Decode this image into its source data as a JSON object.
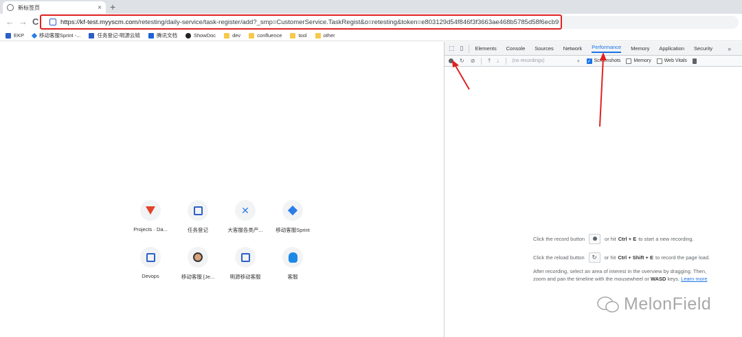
{
  "browser": {
    "tab_title": "新标签页",
    "tab_close": "×",
    "new_tab": "+",
    "back": "←",
    "forward": "→",
    "reload": "C",
    "url_host": "https://kf-test.myyscm.com",
    "url_path": "/retesting/daily-service/task-register/add?_smp=CustomerService.TaskRegist&o=retesting&token=e803129d54f846f3f3663ae468b5785d58f6ecb9"
  },
  "bookmarks": [
    {
      "label": "EKP",
      "icon": "ekp-icon"
    },
    {
      "label": "移动客服Sprint -...",
      "icon": "diamond-icon"
    },
    {
      "label": "任务登记-明源云链",
      "icon": "doc-icon"
    },
    {
      "label": "腾讯文档",
      "icon": "tencent-icon"
    },
    {
      "label": "ShowDoc",
      "icon": "showdoc-icon"
    },
    {
      "label": "dev",
      "icon": "folder-icon"
    },
    {
      "label": "confluence",
      "icon": "folder-icon"
    },
    {
      "label": "tool",
      "icon": "folder-icon"
    },
    {
      "label": "other",
      "icon": "folder-icon"
    }
  ],
  "shortcuts": [
    {
      "label": "Projects · Da...",
      "icon": "gitlab-icon"
    },
    {
      "label": "任务登记",
      "icon": "doc-icon"
    },
    {
      "label": "大客服各类产...",
      "icon": "confluence-icon"
    },
    {
      "label": "移动客服Sprint",
      "icon": "diamond-icon"
    },
    {
      "label": "Devops",
      "icon": "doc-icon"
    },
    {
      "label": "移动客服 [Je...",
      "icon": "avatar-icon"
    },
    {
      "label": "明源移动客服",
      "icon": "doc-icon"
    },
    {
      "label": "客服",
      "icon": "service-icon"
    }
  ],
  "devtools": {
    "tabs": [
      "Elements",
      "Console",
      "Sources",
      "Network",
      "Performance",
      "Memory",
      "Application",
      "Security"
    ],
    "active_tab": "Performance",
    "more": "»",
    "recordings_placeholder": "(no recordings)",
    "checkboxes": [
      {
        "label": "Screenshots",
        "checked": true
      },
      {
        "label": "Memory",
        "checked": false
      },
      {
        "label": "Web Vitals",
        "checked": false
      }
    ],
    "landing": {
      "record_pre": "Click the record button",
      "record_mid": "or hit",
      "record_keys": "Ctrl + E",
      "record_post": "to start a new recording.",
      "reload_pre": "Click the reload button",
      "reload_mid": "or hit",
      "reload_keys": "Ctrl + Shift + E",
      "reload_post": "to record the page load.",
      "after_1": "After recording, select an area of interest in the overview by dragging. Then,",
      "after_2": "zoom and pan the timeline with the mousewheel or",
      "after_keys": "WASD",
      "after_3": "keys.",
      "learn_more": "Learn more"
    }
  },
  "watermark": "MelonField",
  "colors": {
    "annotation": "#e02020",
    "accent": "#1a73e8"
  }
}
